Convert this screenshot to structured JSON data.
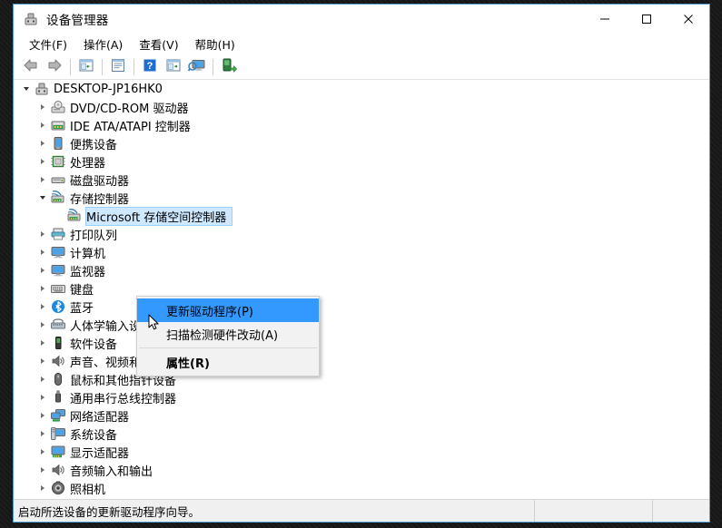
{
  "window": {
    "title": "设备管理器",
    "title_icon": "device-manager-icon",
    "minimize_label": "─",
    "maximize_label": "□",
    "close_label": "✕"
  },
  "menubar": {
    "items": [
      {
        "label": "文件(F)",
        "name": "menu-file"
      },
      {
        "label": "操作(A)",
        "name": "menu-action"
      },
      {
        "label": "查看(V)",
        "name": "menu-view"
      },
      {
        "label": "帮助(H)",
        "name": "menu-help"
      }
    ]
  },
  "toolbar": {
    "buttons": [
      {
        "icon": "back-arrow-icon",
        "name": "toolbar-back"
      },
      {
        "icon": "forward-arrow-icon",
        "name": "toolbar-forward"
      },
      {
        "sep": true
      },
      {
        "icon": "show-hide-console-tree-icon",
        "name": "toolbar-console-tree"
      },
      {
        "sep": true
      },
      {
        "icon": "properties-window-icon",
        "name": "toolbar-properties"
      },
      {
        "sep": true
      },
      {
        "icon": "help-question-icon",
        "name": "toolbar-help"
      },
      {
        "icon": "show-hide-details-pane-icon",
        "name": "toolbar-details-pane"
      },
      {
        "icon": "scan-hardware-changes-icon",
        "name": "toolbar-scan-changes"
      },
      {
        "sep": true
      },
      {
        "icon": "update-driver-icon",
        "name": "toolbar-update-driver"
      }
    ]
  },
  "tree": {
    "root": {
      "label": "DESKTOP-JP16HK0",
      "icon": "computer-root-icon",
      "expanded": true
    },
    "items": [
      {
        "label": "DVD/CD-ROM 驱动器",
        "icon": "dvd-drive-icon",
        "expanded": false,
        "depth": 1
      },
      {
        "label": "IDE ATA/ATAPI 控制器",
        "icon": "ide-controller-icon",
        "expanded": false,
        "depth": 1
      },
      {
        "label": "便携设备",
        "icon": "portable-device-icon",
        "expanded": false,
        "depth": 1
      },
      {
        "label": "处理器",
        "icon": "processor-icon",
        "expanded": false,
        "depth": 1
      },
      {
        "label": "磁盘驱动器",
        "icon": "disk-drive-icon",
        "expanded": false,
        "depth": 1
      },
      {
        "label": "存储控制器",
        "icon": "storage-controller-icon",
        "expanded": true,
        "depth": 1
      },
      {
        "label": "Microsoft 存储空间控制器",
        "icon": "storage-controller-icon",
        "expanded": null,
        "depth": 2,
        "selected": true
      },
      {
        "label": "打印队列",
        "icon": "printer-icon",
        "expanded": false,
        "depth": 1
      },
      {
        "label": "计算机",
        "icon": "computer-icon",
        "expanded": false,
        "depth": 1
      },
      {
        "label": "监视器",
        "icon": "monitor-icon",
        "expanded": false,
        "depth": 1
      },
      {
        "label": "键盘",
        "icon": "keyboard-icon",
        "expanded": false,
        "depth": 1
      },
      {
        "label": "蓝牙",
        "icon": "bluetooth-icon",
        "expanded": false,
        "depth": 1
      },
      {
        "label": "人体学输入设备",
        "icon": "hid-device-icon",
        "expanded": false,
        "depth": 1
      },
      {
        "label": "软件设备",
        "icon": "software-device-icon",
        "expanded": false,
        "depth": 1
      },
      {
        "label": "声音、视频和游戏控制器",
        "icon": "sound-video-game-icon",
        "expanded": false,
        "depth": 1
      },
      {
        "label": "鼠标和其他指针设备",
        "icon": "mouse-icon",
        "expanded": false,
        "depth": 1
      },
      {
        "label": "通用串行总线控制器",
        "icon": "usb-controller-icon",
        "expanded": false,
        "depth": 1
      },
      {
        "label": "网络适配器",
        "icon": "network-adapter-icon",
        "expanded": false,
        "depth": 1
      },
      {
        "label": "系统设备",
        "icon": "system-device-icon",
        "expanded": false,
        "depth": 1
      },
      {
        "label": "显示适配器",
        "icon": "display-adapter-icon",
        "expanded": false,
        "depth": 1
      },
      {
        "label": "音频输入和输出",
        "icon": "audio-io-icon",
        "expanded": false,
        "depth": 1
      },
      {
        "label": "照相机",
        "icon": "camera-icon",
        "expanded": false,
        "depth": 1
      }
    ]
  },
  "context_menu": {
    "items": [
      {
        "label": "更新驱动程序(P)",
        "name": "ctx-update-driver",
        "highlighted": true,
        "bold": false
      },
      {
        "label": "扫描检测硬件改动(A)",
        "name": "ctx-scan-hardware-changes",
        "highlighted": false,
        "bold": false
      },
      {
        "label": "属性(R)",
        "name": "ctx-properties",
        "highlighted": false,
        "bold": true
      }
    ]
  },
  "statusbar": {
    "message": "启动所选设备的更新驱动程序向导。",
    "pane2": "",
    "pane3": ""
  },
  "colors": {
    "window_border": "#4a9ad4",
    "menu_highlight": "#3399ff",
    "tree_selection": "#cde8ff",
    "statusbar_bg": "#f0f0f0"
  }
}
